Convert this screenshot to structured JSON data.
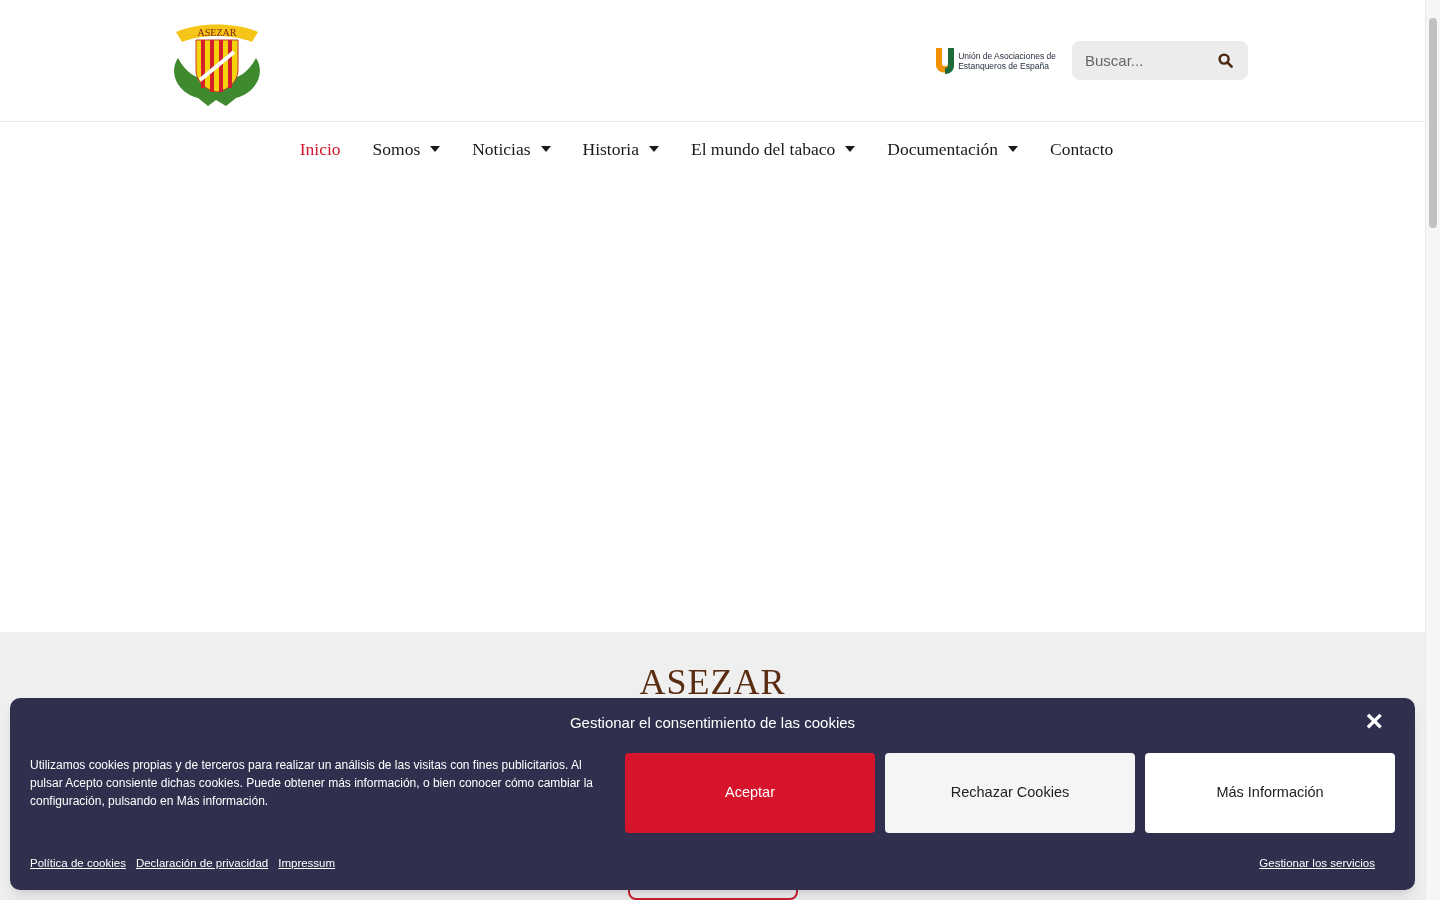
{
  "header": {
    "logo_text": "ASEZAR",
    "partner_logo_text": [
      "Unión de Asociaciones de",
      "Estanqueros de España"
    ],
    "search": {
      "placeholder": "Buscar..."
    }
  },
  "nav": [
    {
      "label": "Inicio",
      "selected": true,
      "dropdown": false
    },
    {
      "label": "Somos",
      "selected": false,
      "dropdown": true
    },
    {
      "label": "Noticias",
      "selected": false,
      "dropdown": true
    },
    {
      "label": "Historia",
      "selected": false,
      "dropdown": true
    },
    {
      "label": "El mundo del tabaco",
      "selected": false,
      "dropdown": true
    },
    {
      "label": "Documentación",
      "selected": false,
      "dropdown": true
    },
    {
      "label": "Contacto",
      "selected": false,
      "dropdown": false
    }
  ],
  "section": {
    "heading": "ASEZAR"
  },
  "cookie_banner": {
    "title": "Gestionar el consentimiento de las cookies",
    "close": "×",
    "message": "Utilizamos cookies propias y de terceros para realizar un análisis de las visitas con fines publicitarios. Al pulsar Acepto consiente dichas cookies. Puede obtener más información, o bien conocer cómo cambiar la configuración, pulsando en Más información.",
    "buttons": [
      {
        "label": "Aceptar",
        "kind": "primary"
      },
      {
        "label": "Rechazar Cookies",
        "kind": "secondary"
      },
      {
        "label": "Más Información",
        "kind": "plain"
      }
    ],
    "links": [
      "Política de cookies",
      "Declaración de privacidad",
      "Impressum"
    ],
    "manage_link": "Gestionar los servicios"
  }
}
